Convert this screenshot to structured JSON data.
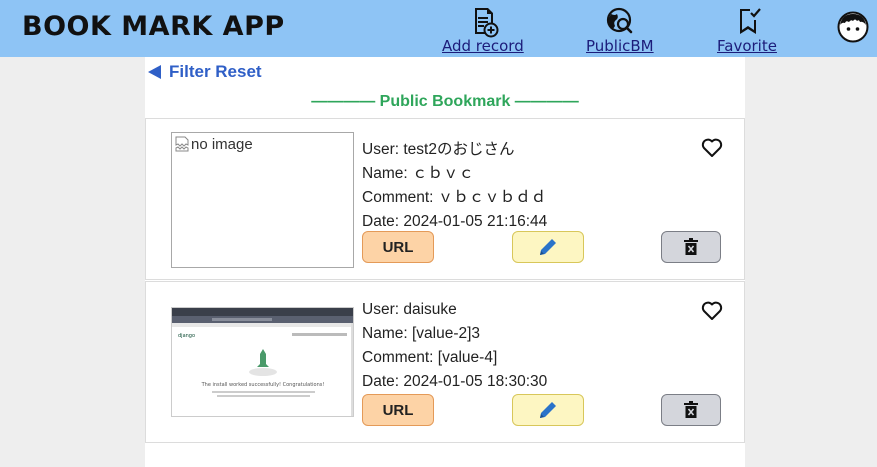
{
  "header": {
    "app_title": "BOOK MARK APP",
    "nav": [
      {
        "label": "Add record",
        "icon": "add-record-icon"
      },
      {
        "label": "PublicBM",
        "icon": "public-search-icon"
      },
      {
        "label": "Favorite",
        "icon": "bookmark-check-icon"
      }
    ],
    "avatar_icon": "user-avatar-icon"
  },
  "filter_reset": "Filter Reset",
  "section_title": "———— Public Bookmark ————",
  "bookmarks": [
    {
      "image_alt": "no image",
      "image_broken": true,
      "user": "User: test2のおじさん",
      "name": "Name: ｃｂｖｃ",
      "comment": "Comment: ｖｂｃｖｂｄｄ",
      "date": "Date: 2024-01-05 21:16:44",
      "url_label": "URL",
      "favorite": false
    },
    {
      "image_alt": "",
      "image_broken": false,
      "user": "User: daisuke",
      "name": "Name: [value-2]3",
      "comment": "Comment: [value-4]",
      "date": "Date: 2024-01-05 18:30:30",
      "url_label": "URL",
      "favorite": false,
      "thumbnail_text": "The install worked successfully! Congratulations!",
      "thumbnail_brand": "django"
    }
  ],
  "colors": {
    "header_bg": "#8ec4f5",
    "link": "#2f5fc7",
    "section_title": "#2fa65b",
    "url_button": "#fdd3a6",
    "edit_button": "#fdf6c2",
    "delete_button": "#d4d6dc",
    "pencil": "#2a73c9"
  }
}
